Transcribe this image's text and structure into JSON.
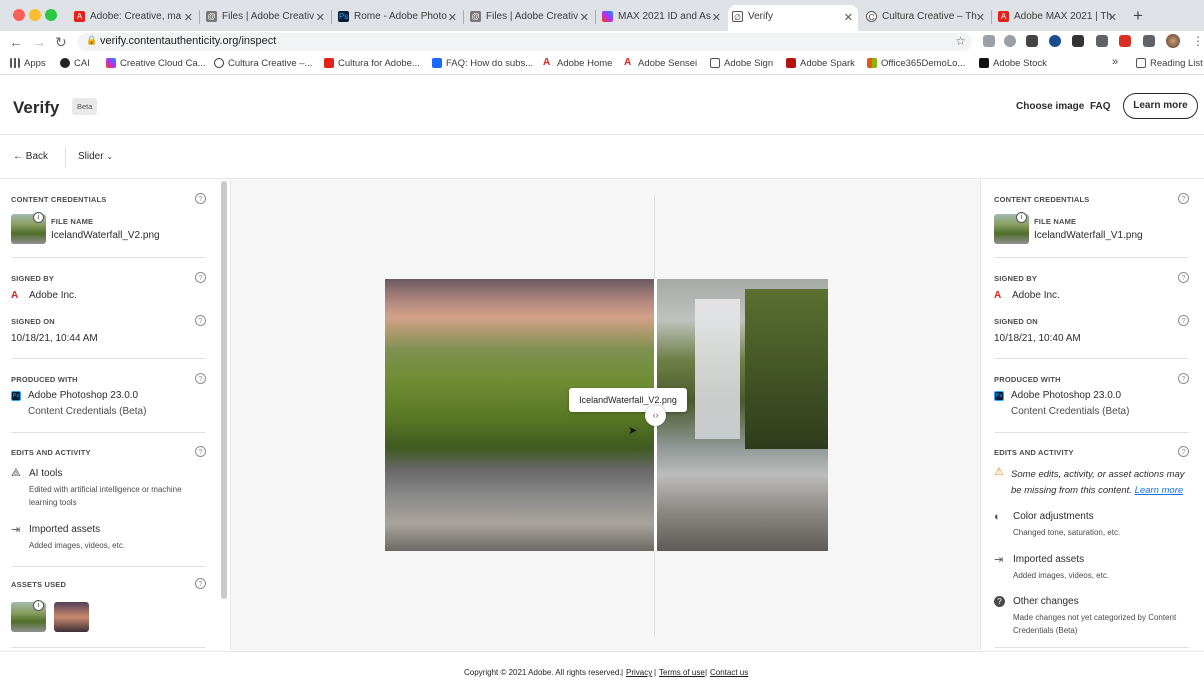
{
  "browser": {
    "tabs": [
      {
        "title": "Adobe: Creative, ma"
      },
      {
        "title": "Files | Adobe Creativ"
      },
      {
        "title": "Rome - Adobe Photo"
      },
      {
        "title": "Files | Adobe Creativ"
      },
      {
        "title": "MAX 2021 ID and As"
      },
      {
        "title": "Verify"
      },
      {
        "title": "Cultura Creative – Th"
      },
      {
        "title": "Adobe MAX 2021 | Th"
      }
    ],
    "url": "verify.contentauthenticity.org/inspect",
    "bookmarks": [
      "Apps",
      "CAI",
      "Creative Cloud Ca...",
      "Cultura Creative –...",
      "Cultura for Adobe...",
      "FAQ: How do subs...",
      "Adobe Home",
      "Adobe Sensei",
      "Adobe Sign",
      "Adobe Spark",
      "Office365DemoLo...",
      "Adobe Stock"
    ],
    "reading_list": "Reading List"
  },
  "header": {
    "logo": "Verify",
    "badge": "Beta",
    "choose_image": "Choose image",
    "faq": "FAQ",
    "learn_more": "Learn more"
  },
  "subbar": {
    "back": "Back",
    "view_mode": "Slider"
  },
  "left_panel": {
    "content_credentials": "CONTENT CREDENTIALS",
    "file_name_label": "FILE NAME",
    "file_name": "IcelandWaterfall_V2.png",
    "signed_by_label": "SIGNED BY",
    "signed_by": "Adobe Inc.",
    "signed_on_label": "SIGNED ON",
    "signed_on": "10/18/21, 10:44 AM",
    "produced_with_label": "PRODUCED WITH",
    "produced_app": "Adobe Photoshop 23.0.0",
    "produced_sub": "Content Credentials (Beta)",
    "edits_label": "EDITS AND ACTIVITY",
    "edits": [
      {
        "title": "AI tools",
        "desc": "Edited with artificial intelligence or machine learning tools"
      },
      {
        "title": "Imported assets",
        "desc": "Added images, videos, etc."
      }
    ],
    "assets_used_label": "ASSETS USED"
  },
  "right_panel": {
    "content_credentials": "CONTENT CREDENTIALS",
    "file_name_label": "FILE NAME",
    "file_name": "IcelandWaterfall_V1.png",
    "signed_by_label": "SIGNED BY",
    "signed_by": "Adobe Inc.",
    "signed_on_label": "SIGNED ON",
    "signed_on": "10/18/21, 10:40 AM",
    "produced_with_label": "PRODUCED WITH",
    "produced_app": "Adobe Photoshop 23.0.0",
    "produced_sub": "Content Credentials (Beta)",
    "edits_label": "EDITS AND ACTIVITY",
    "warning": "Some edits, activity, or asset actions may be missing from this content.",
    "warning_link": "Learn more",
    "edits": [
      {
        "title": "Color adjustments",
        "desc": "Changed tone, saturation, etc."
      },
      {
        "title": "Imported assets",
        "desc": "Added images, videos, etc."
      },
      {
        "title": "Other changes",
        "desc": "Made changes not yet categorized by Content Credentials (Beta)"
      }
    ]
  },
  "canvas": {
    "tooltip": "IcelandWaterfall_V2.png"
  },
  "footer": {
    "copyright": "Copyright © 2021 Adobe. All rights reserved.",
    "privacy": "Privacy",
    "terms": "Terms of use",
    "contact": "Contact us"
  },
  "colors": {
    "adobe_red": "#e3231b",
    "link_blue": "#1473e6",
    "warning": "#e68619"
  }
}
